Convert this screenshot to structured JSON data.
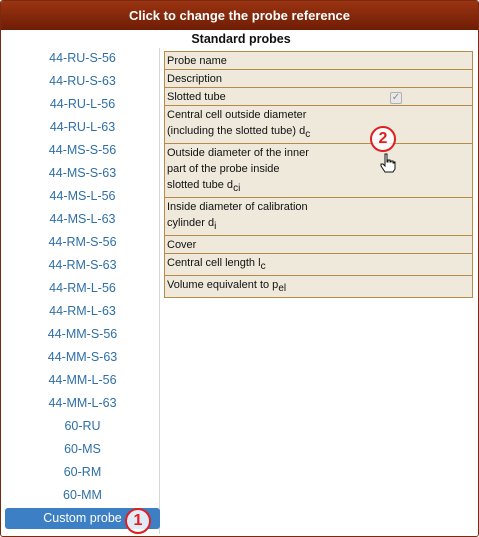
{
  "title_bar": {
    "text": "Click to change the probe reference"
  },
  "section": {
    "title": "Standard probes"
  },
  "sidebar": {
    "items": [
      {
        "label": "44-RU-S-56"
      },
      {
        "label": "44-RU-S-63"
      },
      {
        "label": "44-RU-L-56"
      },
      {
        "label": "44-RU-L-63"
      },
      {
        "label": "44-MS-S-56"
      },
      {
        "label": "44-MS-S-63"
      },
      {
        "label": "44-MS-L-56"
      },
      {
        "label": "44-MS-L-63"
      },
      {
        "label": "44-RM-S-56"
      },
      {
        "label": "44-RM-S-63"
      },
      {
        "label": "44-RM-L-56"
      },
      {
        "label": "44-RM-L-63"
      },
      {
        "label": "44-MM-S-56"
      },
      {
        "label": "44-MM-S-63"
      },
      {
        "label": "44-MM-L-56"
      },
      {
        "label": "44-MM-L-63"
      },
      {
        "label": "60-RU"
      },
      {
        "label": "60-MS"
      },
      {
        "label": "60-RM"
      },
      {
        "label": "60-MM"
      },
      {
        "label": "Custom probe",
        "selected": true
      }
    ]
  },
  "table": {
    "rows": [
      {
        "l1": "Probe name"
      },
      {
        "l1": "Description"
      },
      {
        "l1": "Slotted tube",
        "checked": true
      },
      {
        "l1": "Central cell outside diameter",
        "l2": "(including the slotted tube) d",
        "sub": "c"
      },
      {
        "l1": "Outside diameter of the inner",
        "l2": "part of the probe inside",
        "l3": "slotted tube d",
        "sub": "ci"
      },
      {
        "l1": "Inside diameter of calibration",
        "l2": "cylinder d",
        "sub": "i"
      },
      {
        "l1": "Cover"
      },
      {
        "l1": "Central cell length l",
        "sub": "c"
      },
      {
        "l1": "Volume equivalent to p",
        "sub": "el"
      }
    ]
  },
  "annotations": [
    {
      "number": "1"
    },
    {
      "number": "2"
    }
  ],
  "colors": {
    "title_bar": "#7a2a10",
    "link": "#2e6fa8",
    "selected": "#3d7fc4",
    "table_bg": "#efe9dc",
    "table_border": "#b98a47",
    "annotation": "#e02020"
  },
  "icons": {
    "checkbox": "check-icon",
    "cursor": "hand-pointer-icon"
  }
}
